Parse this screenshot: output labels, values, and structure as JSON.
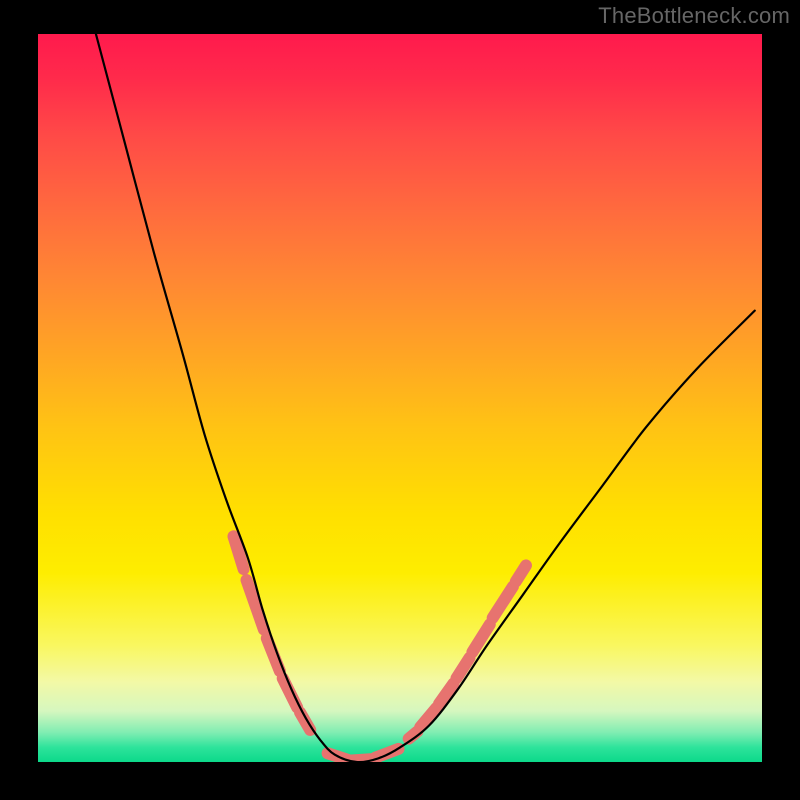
{
  "watermark": "TheBottleneck.com",
  "chart_data": {
    "type": "line",
    "title": "",
    "xlabel": "",
    "ylabel": "",
    "xlim": [
      0,
      100
    ],
    "ylim": [
      0,
      100
    ],
    "gradient_stops": [
      {
        "pos": 0.0,
        "color": "#ff1a4d"
      },
      {
        "pos": 0.06,
        "color": "#ff2a4b"
      },
      {
        "pos": 0.14,
        "color": "#ff4a47"
      },
      {
        "pos": 0.24,
        "color": "#ff6a3e"
      },
      {
        "pos": 0.34,
        "color": "#ff8833"
      },
      {
        "pos": 0.44,
        "color": "#ffa524"
      },
      {
        "pos": 0.54,
        "color": "#ffc314"
      },
      {
        "pos": 0.66,
        "color": "#ffe000"
      },
      {
        "pos": 0.74,
        "color": "#feed00"
      },
      {
        "pos": 0.84,
        "color": "#f9f760"
      },
      {
        "pos": 0.89,
        "color": "#f3f9a6"
      },
      {
        "pos": 0.93,
        "color": "#d6f7bf"
      },
      {
        "pos": 0.96,
        "color": "#7eedb2"
      },
      {
        "pos": 0.98,
        "color": "#2de39b"
      },
      {
        "pos": 1.0,
        "color": "#0cd98a"
      }
    ],
    "series": [
      {
        "name": "bottleneck-curve",
        "x": [
          8,
          12,
          16,
          20,
          23,
          26,
          29,
          31,
          33,
          35,
          37,
          39,
          41,
          44,
          47,
          50,
          54,
          58,
          62,
          67,
          72,
          78,
          84,
          91,
          99
        ],
        "y": [
          100,
          85,
          70,
          56,
          45,
          36,
          28,
          21,
          15,
          10,
          6,
          3,
          1,
          0,
          0.5,
          2,
          5,
          10,
          16,
          23,
          30,
          38,
          46,
          54,
          62
        ]
      }
    ],
    "highlights": [
      {
        "name": "left-highlight",
        "color": "#e7736f",
        "width": 12,
        "segments": [
          {
            "x": [
              27.0,
              28.4
            ],
            "y": [
              31.0,
              26.5
            ]
          },
          {
            "x": [
              28.8,
              31.2
            ],
            "y": [
              25.0,
              18.2
            ]
          },
          {
            "x": [
              31.6,
              33.4
            ],
            "y": [
              17.0,
              12.5
            ]
          },
          {
            "x": [
              33.8,
              35.8
            ],
            "y": [
              11.5,
              7.5
            ]
          },
          {
            "x": [
              36.2,
              37.6
            ],
            "y": [
              6.8,
              4.4
            ]
          }
        ]
      },
      {
        "name": "bottom-highlight",
        "color": "#e7736f",
        "width": 12,
        "segments": [
          {
            "x": [
              40.0,
              42.8
            ],
            "y": [
              1.2,
              0.3
            ]
          },
          {
            "x": [
              43.3,
              46.2
            ],
            "y": [
              0.2,
              0.4
            ]
          },
          {
            "x": [
              46.6,
              49.8
            ],
            "y": [
              0.6,
              1.8
            ]
          }
        ]
      },
      {
        "name": "right-highlight",
        "color": "#e7736f",
        "width": 12,
        "segments": [
          {
            "x": [
              51.2,
              52.4
            ],
            "y": [
              3.2,
              4.2
            ]
          },
          {
            "x": [
              52.8,
              55.0
            ],
            "y": [
              4.8,
              7.4
            ]
          },
          {
            "x": [
              55.4,
              57.4
            ],
            "y": [
              8.0,
              10.8
            ]
          },
          {
            "x": [
              57.8,
              59.6
            ],
            "y": [
              11.5,
              14.3
            ]
          },
          {
            "x": [
              60.0,
              62.4
            ],
            "y": [
              15.1,
              18.9
            ]
          },
          {
            "x": [
              62.8,
              65.6
            ],
            "y": [
              19.8,
              24.1
            ]
          },
          {
            "x": [
              66.0,
              67.4
            ],
            "y": [
              24.8,
              27.0
            ]
          }
        ]
      }
    ]
  }
}
